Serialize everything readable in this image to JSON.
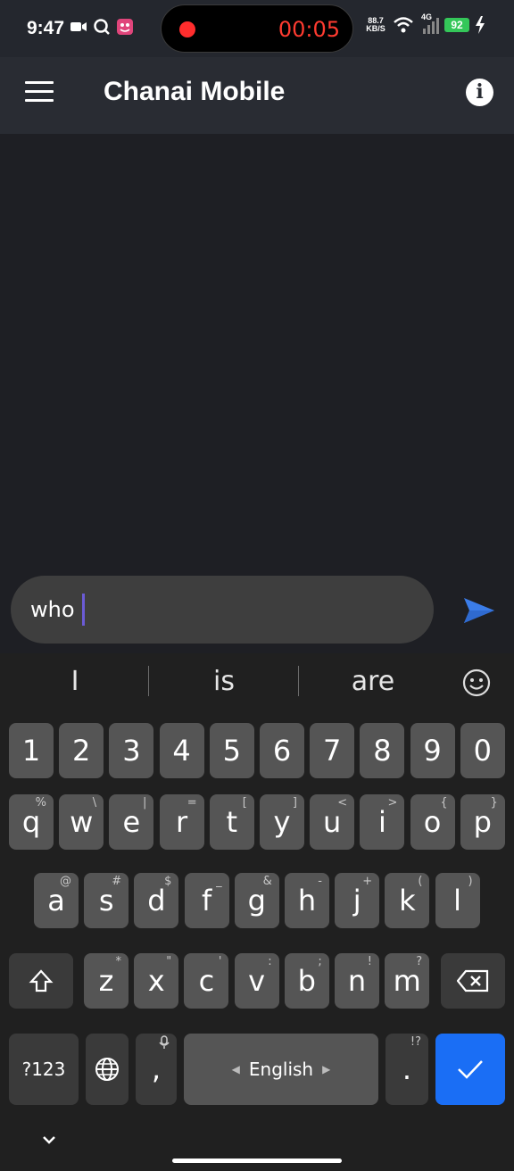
{
  "status_bar": {
    "time": "9:47",
    "recording_timer": "00:05",
    "net_speed_top": "88.7",
    "net_speed_bottom": "KB/S",
    "network_type": "4G",
    "battery": "92"
  },
  "app_bar": {
    "title": "Chanai Mobile",
    "menu_icon": "hamburger-menu-icon",
    "info_icon": "info-icon"
  },
  "composer": {
    "value": "who",
    "send_icon": "send-icon"
  },
  "keyboard": {
    "suggestions": [
      "I",
      "is",
      "are"
    ],
    "number_row": [
      "1",
      "2",
      "3",
      "4",
      "5",
      "6",
      "7",
      "8",
      "9",
      "0"
    ],
    "row1": [
      {
        "key": "q",
        "hint": "%"
      },
      {
        "key": "w",
        "hint": "\\"
      },
      {
        "key": "e",
        "hint": "|"
      },
      {
        "key": "r",
        "hint": "="
      },
      {
        "key": "t",
        "hint": "["
      },
      {
        "key": "y",
        "hint": "]"
      },
      {
        "key": "u",
        "hint": "<"
      },
      {
        "key": "i",
        "hint": ">"
      },
      {
        "key": "o",
        "hint": "{"
      },
      {
        "key": "p",
        "hint": "}"
      }
    ],
    "row2": [
      {
        "key": "a",
        "hint": "@"
      },
      {
        "key": "s",
        "hint": "#"
      },
      {
        "key": "d",
        "hint": "$"
      },
      {
        "key": "f",
        "hint": "_"
      },
      {
        "key": "g",
        "hint": "&"
      },
      {
        "key": "h",
        "hint": "-"
      },
      {
        "key": "j",
        "hint": "+"
      },
      {
        "key": "k",
        "hint": "("
      },
      {
        "key": "l",
        "hint": ")"
      }
    ],
    "row3": [
      {
        "key": "z",
        "hint": "*"
      },
      {
        "key": "x",
        "hint": "\""
      },
      {
        "key": "c",
        "hint": "'"
      },
      {
        "key": "v",
        "hint": ":"
      },
      {
        "key": "b",
        "hint": ";"
      },
      {
        "key": "n",
        "hint": "!"
      },
      {
        "key": "m",
        "hint": "?"
      }
    ],
    "symbols_key": "?123",
    "comma_key": ",",
    "space_label": "English",
    "period_key": ".",
    "period_hint": "!?"
  }
}
